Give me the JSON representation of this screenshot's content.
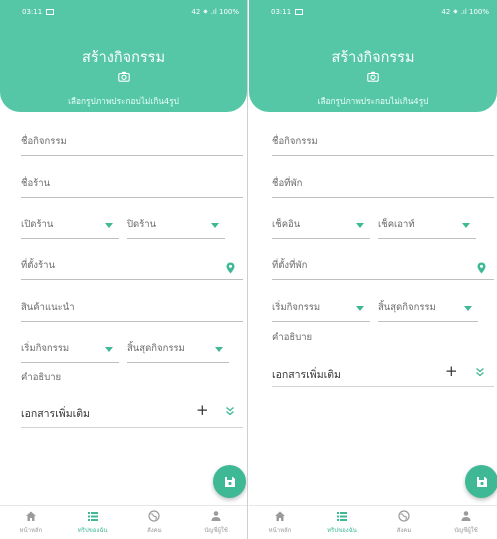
{
  "left": {
    "status": {
      "time": "03:11",
      "right": "42 ✷ .ıl 100%"
    },
    "header": {
      "title": "สร้างกิจกรรม",
      "photo_hint": "เลือกรูปภาพประกอบไม่เกิน4รูป"
    },
    "form": {
      "activity_name": "ชื่อกิจกรรม",
      "shop_name": "ชื่อร้าน",
      "open_shop": "เปิดร้าน",
      "close_shop": "ปิดร้าน",
      "shop_location": "ที่ตั้งร้าน",
      "recommended_product": "สินค้าแนะนำ",
      "start_activity": "เริ่มกิจกรรม",
      "end_activity": "สิ้นสุดกิจกรรม",
      "description": "คำอธิบาย"
    },
    "extra_docs": {
      "title": "เอกสารเพิ่มเติม",
      "add": "+"
    }
  },
  "right": {
    "status": {
      "time": "03:11",
      "right": "42 ✷ .ıl 100%"
    },
    "header": {
      "title": "สร้างกิจกรรม",
      "photo_hint": "เลือกรูปภาพประกอบไม่เกิน4รูป"
    },
    "form": {
      "activity_name": "ชื่อกิจกรรม",
      "lodging_name": "ชื่อที่พัก",
      "check_in": "เช็คอิน",
      "check_out": "เช็คเอาท์",
      "lodging_location": "ที่ตั้งที่พัก",
      "start_activity": "เริ่มกิจกรรม",
      "end_activity": "สิ้นสุดกิจกรรม",
      "description": "คำอธิบาย"
    },
    "extra_docs": {
      "title": "เอกสารเพิ่มเติม",
      "add": "+"
    }
  },
  "nav": {
    "home": "หน้าหลัก",
    "my_trips": "ทริปของฉัน",
    "social": "สังคม",
    "account": "บัญชีผู้ใช้"
  },
  "colors": {
    "primary": "#56c7a6",
    "accent": "#3fb896"
  },
  "icons": [
    "camera-icon",
    "chevron-down-icon",
    "location-pin-icon",
    "plus-icon",
    "double-chevron-down-icon",
    "save-icon",
    "home-icon",
    "list-icon",
    "globe-icon",
    "person-icon",
    "image-icon"
  ]
}
